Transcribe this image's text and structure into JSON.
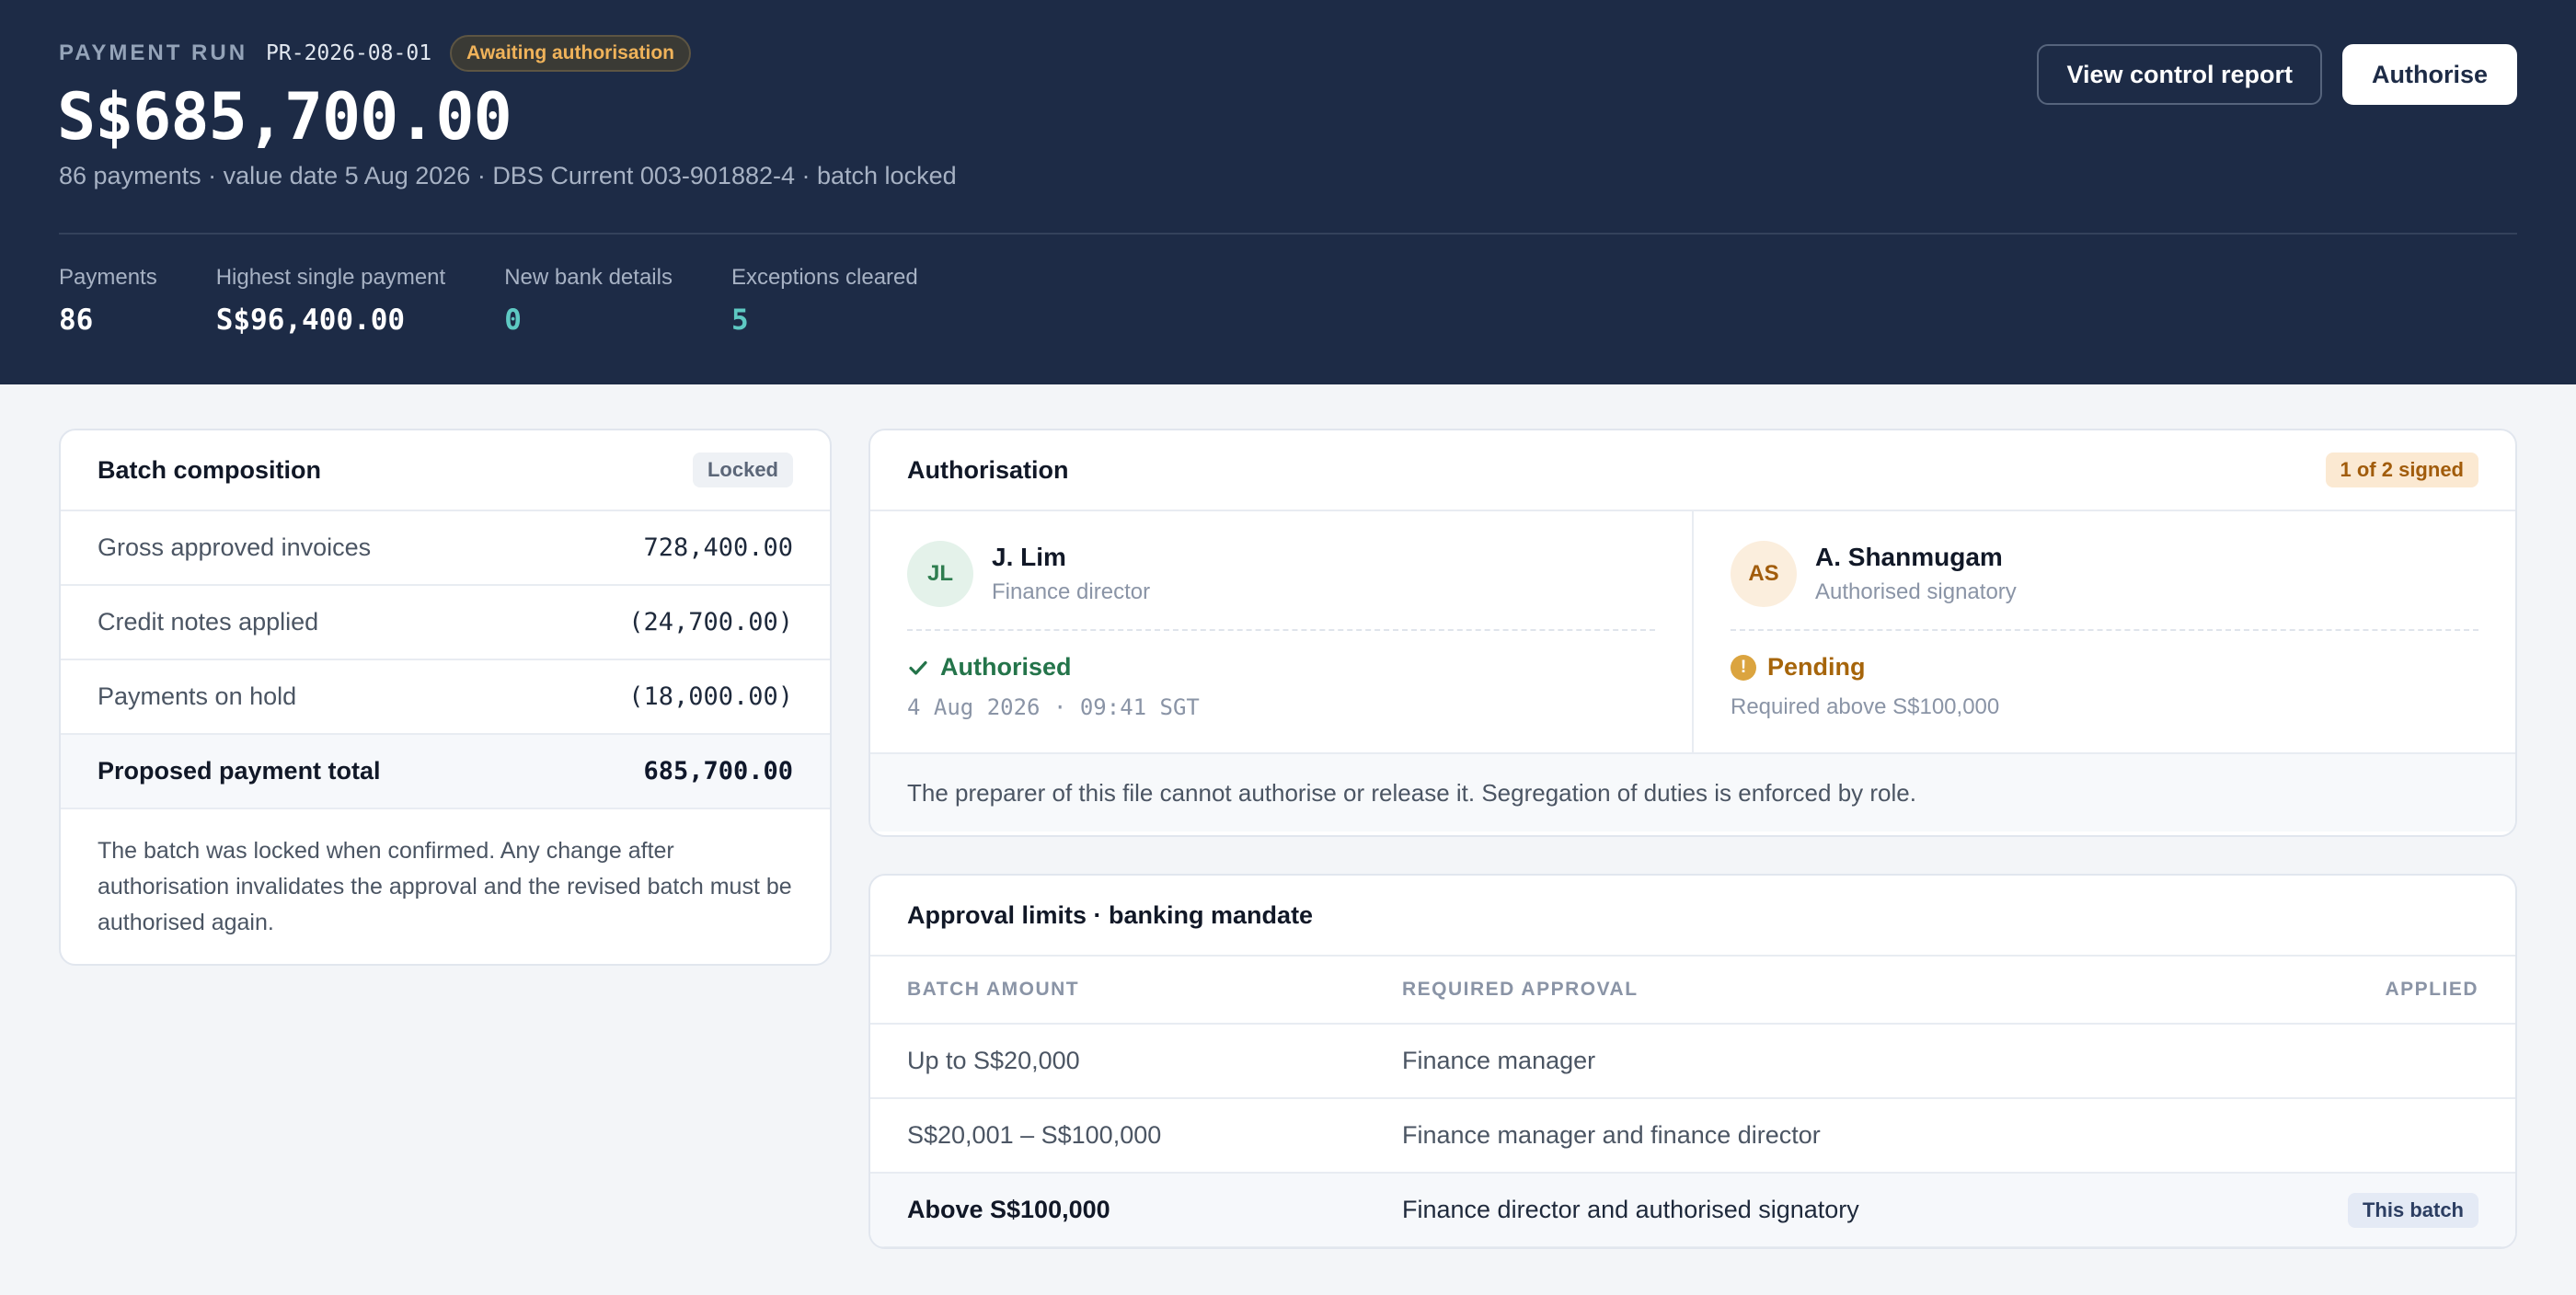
{
  "header": {
    "eyebrow": "PAYMENT RUN",
    "run_id": "PR-2026-08-01",
    "status": "Awaiting authorisation",
    "amount": "S$685,700.00",
    "subline": "86 payments · value date 5 Aug 2026 · DBS Current 003-901882-4 · batch locked",
    "buttons": {
      "report": "View control report",
      "authorise": "Authorise"
    },
    "stats": [
      {
        "label": "Payments",
        "value": "86"
      },
      {
        "label": "Highest single payment",
        "value": "S$96,400.00"
      },
      {
        "label": "New bank details",
        "value": "0"
      },
      {
        "label": "Exceptions cleared",
        "value": "5"
      }
    ]
  },
  "composition": {
    "title": "Batch composition",
    "badge": "Locked",
    "rows": [
      {
        "label": "Gross approved invoices",
        "value": "728,400.00"
      },
      {
        "label": "Credit notes applied",
        "value": "(24,700.00)"
      },
      {
        "label": "Payments on hold",
        "value": "(18,000.00)"
      }
    ],
    "total": {
      "label": "Proposed payment total",
      "value": "685,700.00"
    },
    "note": "The batch was locked when confirmed. Any change after authorisation invalidates the approval and the revised batch must be authorised again."
  },
  "authorisation": {
    "title": "Authorisation",
    "badge": "1 of 2 signed",
    "signers": [
      {
        "initials": "JL",
        "name": "J. Lim",
        "role": "Finance director",
        "status": "Authorised",
        "meta": "4 Aug 2026 · 09:41 SGT"
      },
      {
        "initials": "AS",
        "name": "A. Shanmugam",
        "role": "Authorised signatory",
        "status": "Pending",
        "meta": "Required above S$100,000"
      }
    ],
    "footer": "The preparer of this file cannot authorise or release it. Segregation of duties is enforced by role."
  },
  "limits": {
    "title": "Approval limits · banking mandate",
    "columns": [
      "BATCH AMOUNT",
      "REQUIRED APPROVAL",
      "APPLIED"
    ],
    "rows": [
      {
        "amount": "Up to S$20,000",
        "approval": "Finance manager",
        "applied": ""
      },
      {
        "amount": "S$20,001 – S$100,000",
        "approval": "Finance manager and finance director",
        "applied": ""
      },
      {
        "amount": "Above S$100,000",
        "approval": "Finance director and authorised signatory",
        "applied": "This batch"
      }
    ]
  }
}
